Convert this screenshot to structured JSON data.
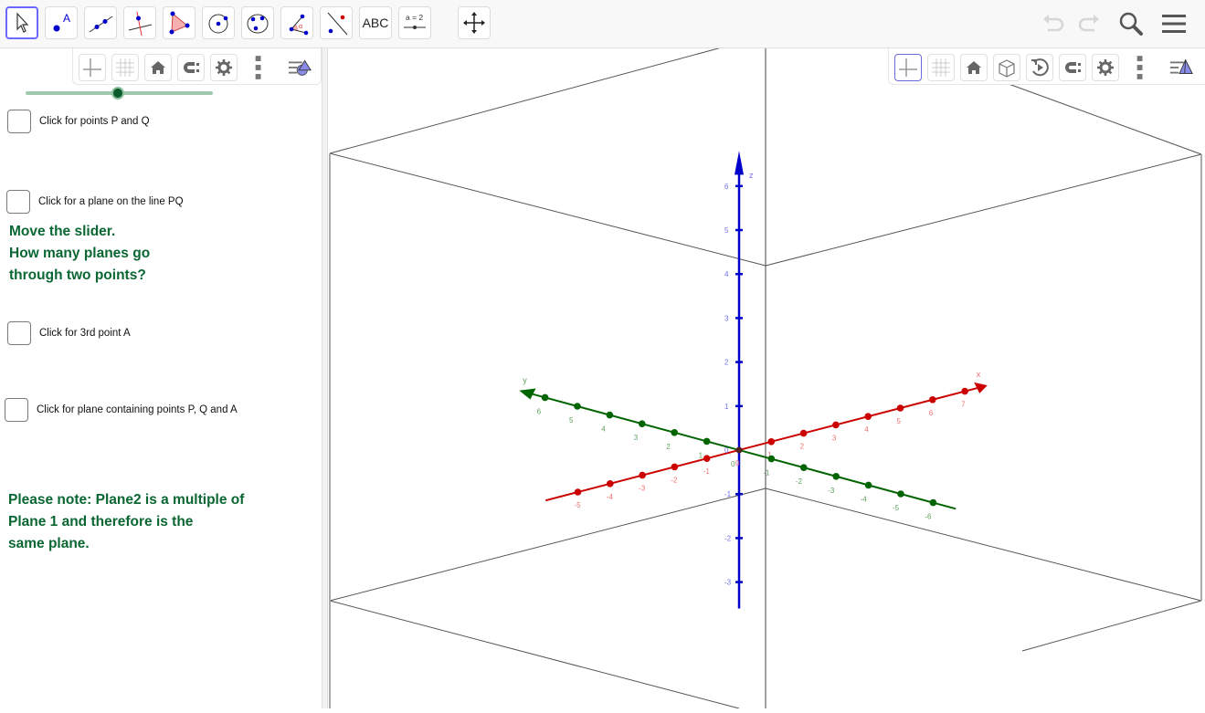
{
  "toolbar": {
    "tools": [
      {
        "name": "move-tool",
        "icon": "arrow-cursor-icon",
        "active": true
      },
      {
        "name": "point-tool",
        "icon": "point-a-icon",
        "label": "A"
      },
      {
        "name": "line-tool",
        "icon": "line-two-points-icon"
      },
      {
        "name": "perpendicular-line-tool",
        "icon": "perpendicular-line-icon"
      },
      {
        "name": "polygon-tool",
        "icon": "polygon-icon"
      },
      {
        "name": "circle-tool",
        "icon": "circle-center-point-icon"
      },
      {
        "name": "circle-three-points-tool",
        "icon": "circle-three-points-icon"
      },
      {
        "name": "angle-tool",
        "icon": "angle-icon",
        "label": "α"
      },
      {
        "name": "reflect-tool",
        "icon": "reflect-line-icon"
      },
      {
        "name": "text-tool",
        "icon": "text-icon",
        "label": "ABC"
      },
      {
        "name": "slider-tool",
        "icon": "slider-icon",
        "label": "a = 2"
      },
      {
        "name": "move-view-tool",
        "icon": "move-graphics-icon"
      }
    ],
    "right": {
      "undo": "undo-icon",
      "redo": "redo-icon",
      "search": "search-icon",
      "menu": "menu-icon"
    }
  },
  "left_panel": {
    "stylebar": [
      "axes-toggle",
      "grid-toggle",
      "home-view",
      "point-capturing",
      "settings",
      "more-menu",
      "view-toggle"
    ],
    "slider": {
      "value_fraction": 0.5,
      "color": "#0a5c2c"
    },
    "checkboxes": [
      {
        "label": "Click for points P and Q",
        "checked": false
      },
      {
        "label": "Click for a plane on the line PQ",
        "checked": false
      },
      {
        "label": "Click for 3rd point A",
        "checked": false
      },
      {
        "label": "Click for plane containing points P, Q and A",
        "checked": false
      }
    ],
    "prompt": {
      "line1": "Move the slider.",
      "line2": "How many planes go",
      "line3": "through two points?"
    },
    "note": {
      "line1": "Please note: Plane2 is a multiple of",
      "line2": "Plane 1 and therefore is the",
      "line3": "same plane."
    },
    "text_color": "#0a6632"
  },
  "graphics3d": {
    "stylebar": [
      "axes-toggle",
      "grid-toggle",
      "home-view",
      "view-in-front",
      "rotate-view",
      "point-capturing",
      "settings",
      "more-menu",
      "view-toggle"
    ],
    "axes": {
      "x": {
        "label": "x",
        "color": "#cc0000",
        "ticks": [
          "-5",
          "-4",
          "-3",
          "-2",
          "-1",
          "0",
          "1",
          "2",
          "3",
          "4",
          "5",
          "6",
          "7"
        ]
      },
      "y": {
        "label": "y",
        "color": "#006400",
        "ticks": [
          "6",
          "5",
          "4",
          "3",
          "2",
          "1",
          "0",
          "-1",
          "-2",
          "-3",
          "-4",
          "-5",
          "-6"
        ]
      },
      "z": {
        "label": "z",
        "color": "#0000cc",
        "ticks": [
          "6",
          "5",
          "4",
          "3",
          "2",
          "1",
          "0",
          "-1",
          "-2",
          "-3"
        ]
      }
    }
  }
}
